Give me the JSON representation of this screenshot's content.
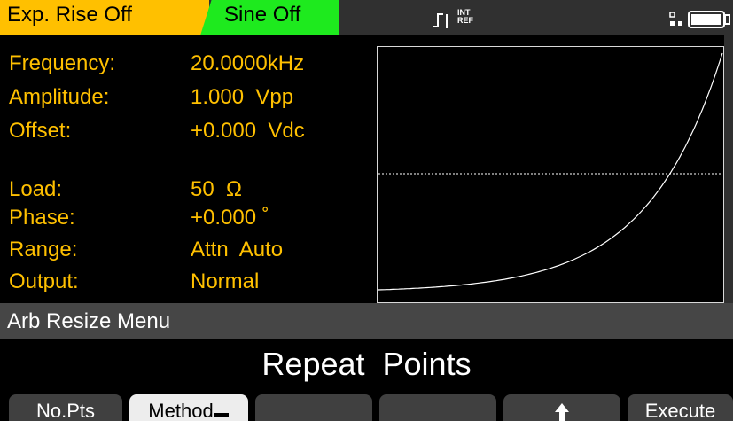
{
  "status_bar": {
    "channel1_label": "Exp. Rise Off",
    "channel2_label": "Sine Off",
    "ref_label_top": "INT",
    "ref_label_bottom": "REF",
    "colors": {
      "channel1_bg": "#ffc000",
      "channel2_bg": "#1eea1e"
    },
    "icons": [
      "trigger-edge-icon",
      "network-icon",
      "battery-icon"
    ]
  },
  "parameters": [
    {
      "label": "Frequency:",
      "value": "20.0000kHz"
    },
    {
      "label": "Amplitude:",
      "value": "1.000  Vpp"
    },
    {
      "label": "Offset:",
      "value": "+0.000  Vdc"
    },
    {
      "label": "Load:",
      "value": "50  Ω"
    },
    {
      "label": "Phase:",
      "value": "+0.000 ˚"
    },
    {
      "label": "Range:",
      "value": "Attn  Auto"
    },
    {
      "label": "Output:",
      "value": "Normal"
    }
  ],
  "waveform": {
    "shape": "exponential-rise"
  },
  "menu": {
    "title": "Arb  Resize  Menu",
    "current_value": "Repeat  Points"
  },
  "softkeys": [
    {
      "label": "No.Pts",
      "selected": false
    },
    {
      "label": "Method",
      "selected": true,
      "has_dropdown": true
    },
    {
      "label": "",
      "selected": false
    },
    {
      "label": "",
      "selected": false
    },
    {
      "label": "",
      "icon": "up-arrow-icon",
      "selected": false
    },
    {
      "label": "Execute",
      "selected": false
    }
  ]
}
